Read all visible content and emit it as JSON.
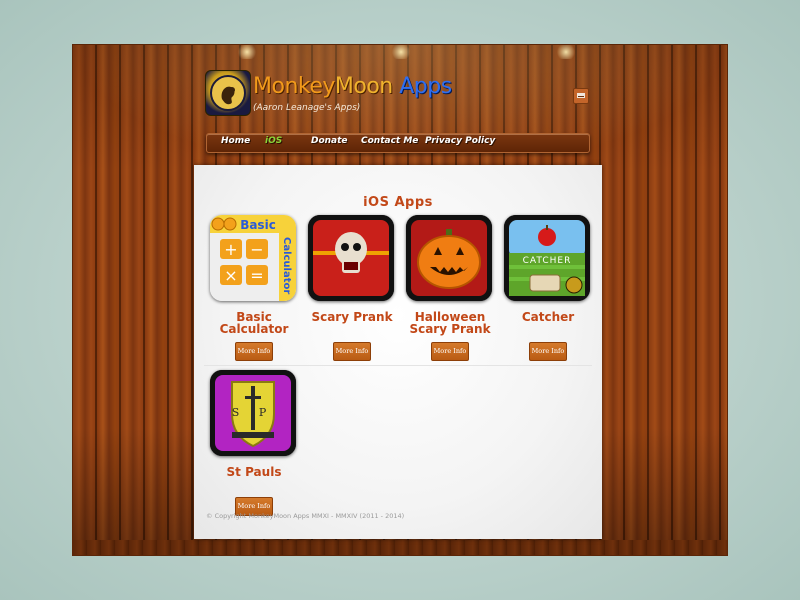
{
  "header": {
    "title_part1": "Monkey",
    "title_part2": "Moon",
    "title_part3": " Apps",
    "subtitle": "(Aaron Leanage's Apps)"
  },
  "nav": [
    {
      "label": "Home"
    },
    {
      "label": "iOS"
    },
    {
      "label": "Donate"
    },
    {
      "label": "Contact Me"
    },
    {
      "label": "Privacy Policy"
    }
  ],
  "main": {
    "section_title": "iOS Apps",
    "apps": [
      {
        "name_line1": "Basic",
        "name_line2": "Calculator",
        "button": "More Info",
        "icon_text_top": "Basic",
        "icon_text_side": "Calculator"
      },
      {
        "name_line1": "Scary Prank",
        "name_line2": "",
        "button": "More Info"
      },
      {
        "name_line1": "Halloween",
        "name_line2": "Scary Prank",
        "button": "More Info"
      },
      {
        "name_line1": "Catcher",
        "name_line2": "",
        "button": "More Info",
        "icon_text": "CATCHER"
      },
      {
        "name_line1": "St Pauls",
        "name_line2": "",
        "button": "More Info",
        "icon_letters": "S P"
      }
    ],
    "copyright": "© Copyright MonkeyMoon Apps MMXI - MMXIV (2011 - 2014)"
  },
  "icons": {
    "logo": "monkey-moon-logo-icon",
    "mail": "mail-icon"
  },
  "colors": {
    "accent": "#c24818",
    "nav_active": "#8bd43a",
    "button": "#c96a20"
  }
}
